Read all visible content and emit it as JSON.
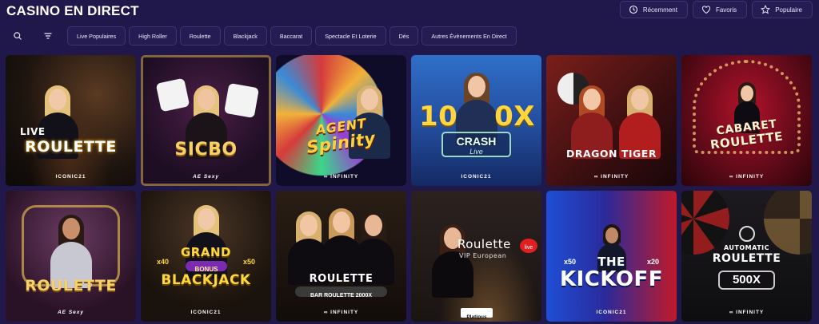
{
  "header": {
    "title": "CASINO EN DIRECT",
    "actions": [
      {
        "label": "Récemment",
        "icon": "history-icon"
      },
      {
        "label": "Favoris",
        "icon": "heart-icon"
      },
      {
        "label": "Populaire",
        "icon": "star-icon"
      }
    ]
  },
  "filters": {
    "search_icon": "search-icon",
    "filter_icon": "filter-icon",
    "chips": [
      "Live Populaires",
      "High Roller",
      "Roulette",
      "Blackjack",
      "Baccarat",
      "Spectacle Et Loterie",
      "Dés",
      "Autres Évènements En Direct"
    ]
  },
  "games": [
    {
      "line1": "LIVE",
      "line2": "ROULETTE",
      "provider": "ICONIC21"
    },
    {
      "line1": "",
      "line2": "SICBO",
      "provider": "AE Sexy"
    },
    {
      "line1": "AGENT",
      "line2": "Spinity",
      "provider": "∞ INFINITY"
    },
    {
      "line1": "10",
      "line2": "0X",
      "crash": "CRASH",
      "crash_sub": "Live",
      "provider": "ICONIC21"
    },
    {
      "line1": "",
      "line2": "DRAGON TIGER",
      "provider": "∞ INFINITY"
    },
    {
      "line1": "CABARET",
      "line2": "ROULETTE",
      "provider": "∞ INFINITY"
    },
    {
      "line1": "",
      "line2": "ROULETTE",
      "provider": "AE Sexy"
    },
    {
      "line1": "GRAND",
      "bonus": "BONUS",
      "left_mult": "x40",
      "right_mult": "x50",
      "line2": "BLACKJACK",
      "provider": "ICONIC21"
    },
    {
      "line1": "ROULETTE",
      "line2": "BAR ROULETTE 2000X",
      "provider": "∞ INFINITY"
    },
    {
      "line1": "Roulette",
      "live": "live",
      "line2": "VIP European",
      "provider": "Platipus"
    },
    {
      "line1": "THE",
      "line2": "KICKOFF",
      "left_mult": "x50",
      "right_mult": "x20",
      "provider": "ICONIC21"
    },
    {
      "line1": "AUTOMATIC",
      "line2": "ROULETTE",
      "badge": "500X",
      "provider": "∞ INFINITY"
    }
  ],
  "colors": {
    "background": "#20184a",
    "chip_bg": "#241c52",
    "chip_border": "#3d3570",
    "gold": "#f4c542"
  }
}
